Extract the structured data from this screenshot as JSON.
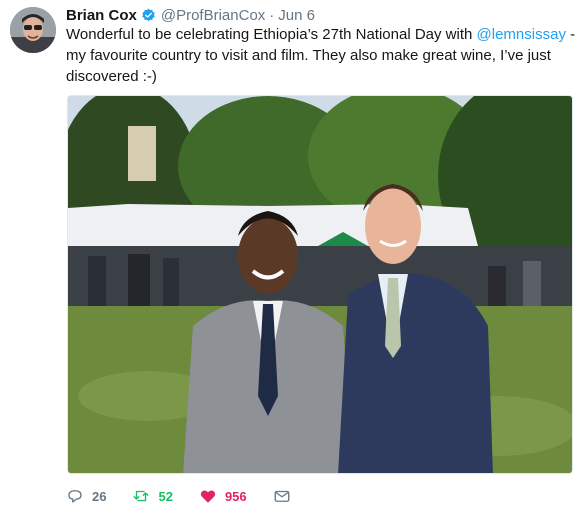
{
  "tweet": {
    "author_name": "Brian Cox",
    "handle": "@ProfBrianCox",
    "separator": "·",
    "date": "Jun 6",
    "text_before": "Wonderful to be celebrating Ethiopia’s 27th National Day with ",
    "mention": "@lemnsissay",
    "text_after": " - my favourite country to visit and film. They also make great wine, I’ve just discovered :-)",
    "photo_icon": "photo-of-two-men-at-garden-party"
  },
  "actions": {
    "reply_count": "26",
    "retweet_count": "52",
    "like_count": "956",
    "reply_icon": "reply-icon",
    "retweet_icon": "retweet-icon",
    "like_icon": "heart-icon",
    "dm_icon": "envelope-icon"
  },
  "colors": {
    "link": "#1da1f2",
    "retweet": "#17bf63",
    "like": "#e0245e",
    "muted": "#657786"
  }
}
